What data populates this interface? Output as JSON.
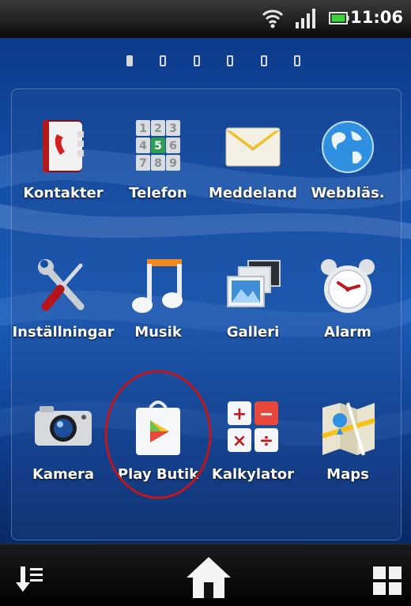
{
  "status_bar": {
    "time": "11:06",
    "icons": [
      "wifi-icon",
      "signal-icon",
      "battery-icon"
    ]
  },
  "pager": {
    "page_count": 6,
    "active_index": 0
  },
  "apps": [
    {
      "label": "Kontakter",
      "icon": "contacts-icon"
    },
    {
      "label": "Telefon",
      "icon": "phone-keypad-icon"
    },
    {
      "label": "Meddeland",
      "icon": "envelope-icon"
    },
    {
      "label": "Webbläs.",
      "icon": "globe-icon"
    },
    {
      "label": "Inställningar",
      "icon": "wrench-screwdriver-icon"
    },
    {
      "label": "Musik",
      "icon": "music-note-icon"
    },
    {
      "label": "Galleri",
      "icon": "gallery-icon"
    },
    {
      "label": "Alarm",
      "icon": "alarm-clock-icon"
    },
    {
      "label": "Kamera",
      "icon": "camera-icon"
    },
    {
      "label": "Play Butik",
      "icon": "play-store-bag-icon"
    },
    {
      "label": "Kalkylator",
      "icon": "calculator-icon"
    },
    {
      "label": "Maps",
      "icon": "map-icon"
    }
  ],
  "keypad_digits": [
    "1",
    "2",
    "3",
    "4",
    "5",
    "6",
    "7",
    "8",
    "9"
  ],
  "calculator_symbols": [
    "+",
    "−",
    "×",
    "÷"
  ],
  "highlight": {
    "target": "Play Butik",
    "color": "#c0161c"
  },
  "dock": {
    "left": "sort-down-icon",
    "center": "home-icon",
    "right": "app-grid-icon"
  }
}
